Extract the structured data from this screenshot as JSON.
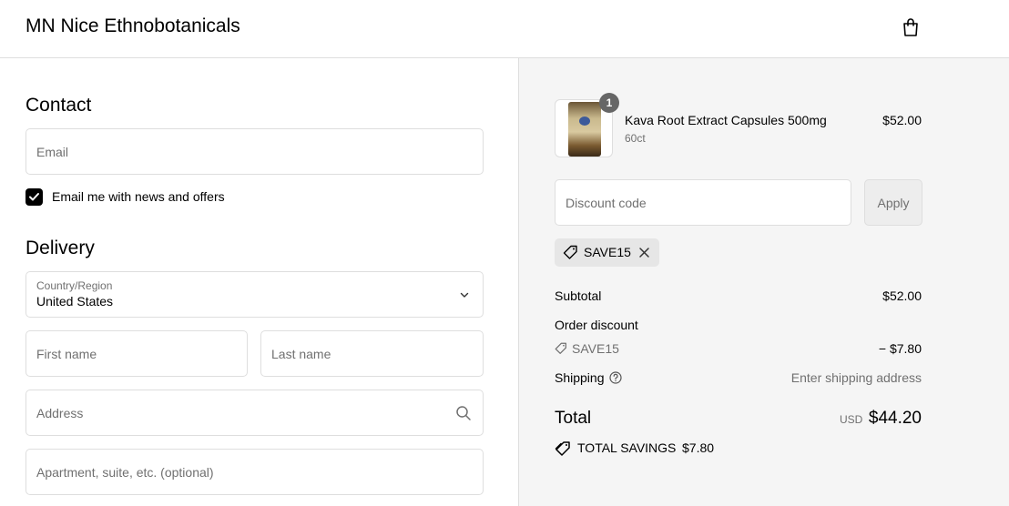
{
  "header": {
    "store_name": "MN Nice Ethnobotanicals"
  },
  "contact": {
    "title": "Contact",
    "email_placeholder": "Email",
    "newsletter_label": "Email me with news and offers",
    "newsletter_checked": true
  },
  "delivery": {
    "title": "Delivery",
    "country_label": "Country/Region",
    "country_value": "United States",
    "first_name_placeholder": "First name",
    "last_name_placeholder": "Last name",
    "address_placeholder": "Address",
    "apartment_placeholder": "Apartment, suite, etc. (optional)"
  },
  "cart": {
    "item": {
      "quantity": "1",
      "name": "Kava Root Extract Capsules 500mg",
      "variant": "60ct",
      "price": "$52.00"
    },
    "discount_placeholder": "Discount code",
    "apply_label": "Apply",
    "applied_code": "SAVE15",
    "subtotal_label": "Subtotal",
    "subtotal_value": "$52.00",
    "order_discount_label": "Order discount",
    "discount_code": "SAVE15",
    "discount_value": "− $7.80",
    "shipping_label": "Shipping",
    "shipping_value": "Enter shipping address",
    "total_label": "Total",
    "currency": "USD",
    "total_value": "$44.20",
    "savings_label": "TOTAL SAVINGS",
    "savings_value": "$7.80"
  },
  "colors": {
    "accent": "#000000",
    "muted_text": "#707070",
    "summary_bg": "#f5f5f5",
    "border": "#dedede"
  },
  "icons": [
    "shopping-bag-icon",
    "chevron-down-icon",
    "search-icon",
    "checkmark-icon",
    "tag-icon",
    "close-icon",
    "help-icon",
    "savings-tag-icon"
  ]
}
